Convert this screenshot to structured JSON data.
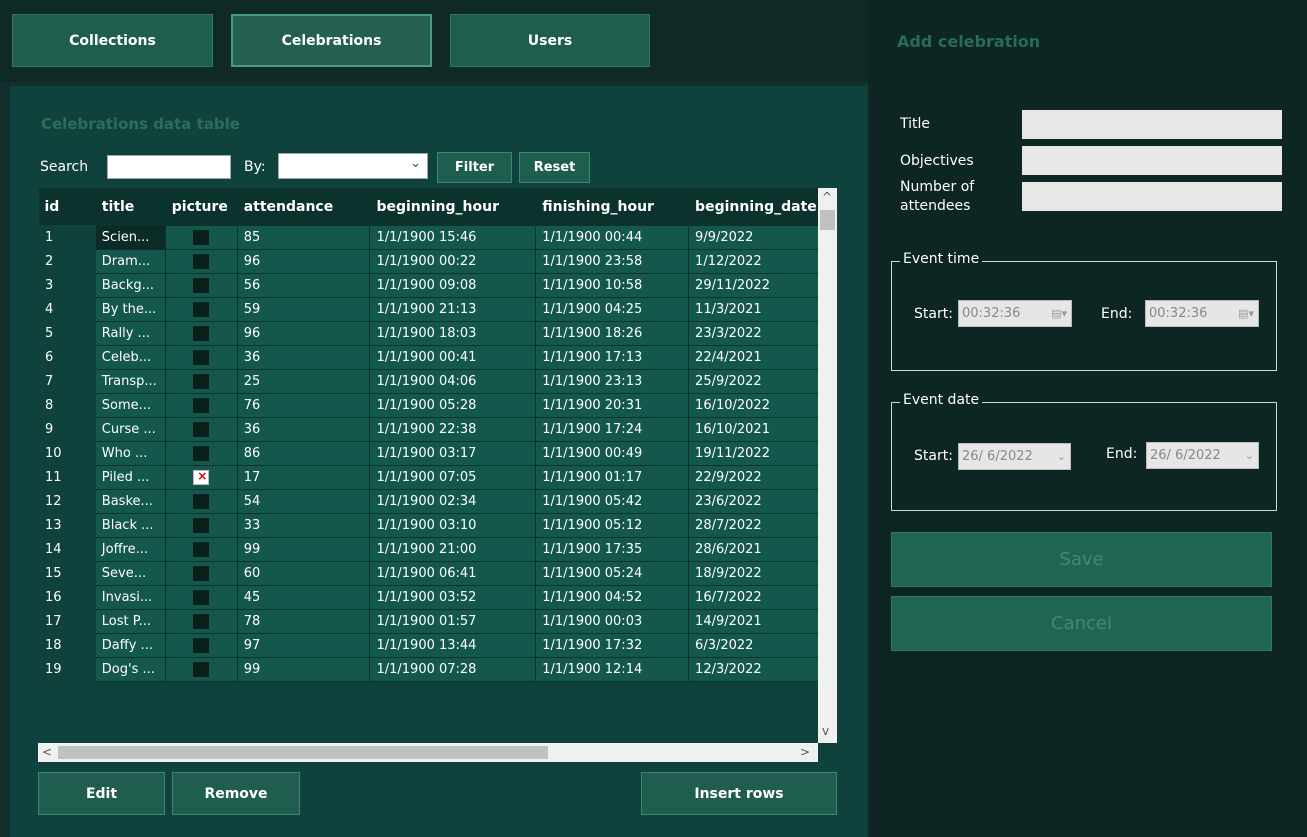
{
  "nav": {
    "collections": "Collections",
    "celebrations": "Celebrations",
    "users": "Users"
  },
  "app_title": "Add celebration",
  "table_title": "Celebrations data table",
  "search": {
    "label": "Search",
    "value": "",
    "by_label": "By:",
    "by_value": "",
    "filter": "Filter",
    "reset": "Reset"
  },
  "table": {
    "columns": [
      "id",
      "title",
      "picture",
      "attendance",
      "beginning_hour",
      "finishing_hour",
      "beginning_date"
    ],
    "rows": [
      [
        "1",
        "Scien...",
        "",
        "85",
        "1/1/1900 15:46",
        "1/1/1900 00:44",
        "9/9/2022"
      ],
      [
        "2",
        "Dram...",
        "",
        "96",
        "1/1/1900 00:22",
        "1/1/1900 23:58",
        "1/12/2022"
      ],
      [
        "3",
        "Backg...",
        "",
        "56",
        "1/1/1900 09:08",
        "1/1/1900 10:58",
        "29/11/2022"
      ],
      [
        "4",
        "By the...",
        "",
        "59",
        "1/1/1900 21:13",
        "1/1/1900 04:25",
        "11/3/2021"
      ],
      [
        "5",
        "Rally ...",
        "",
        "96",
        "1/1/1900 18:03",
        "1/1/1900 18:26",
        "23/3/2022"
      ],
      [
        "6",
        "Celeb...",
        "",
        "36",
        "1/1/1900 00:41",
        "1/1/1900 17:13",
        "22/4/2021"
      ],
      [
        "7",
        "Transp...",
        "",
        "25",
        "1/1/1900 04:06",
        "1/1/1900 23:13",
        "25/9/2022"
      ],
      [
        "8",
        "Some...",
        "",
        "76",
        "1/1/1900 05:28",
        "1/1/1900 20:31",
        "16/10/2022"
      ],
      [
        "9",
        "Curse ...",
        "",
        "36",
        "1/1/1900 22:38",
        "1/1/1900 17:24",
        "16/10/2021"
      ],
      [
        "10",
        "Who ...",
        "",
        "86",
        "1/1/1900 03:17",
        "1/1/1900 00:49",
        "19/11/2022"
      ],
      [
        "11",
        "Piled ...",
        "broken",
        "17",
        "1/1/1900 07:05",
        "1/1/1900 01:17",
        "22/9/2022"
      ],
      [
        "12",
        "Baske...",
        "",
        "54",
        "1/1/1900 02:34",
        "1/1/1900 05:42",
        "23/6/2022"
      ],
      [
        "13",
        "Black ...",
        "",
        "33",
        "1/1/1900 03:10",
        "1/1/1900 05:12",
        "28/7/2022"
      ],
      [
        "14",
        "Joffre...",
        "",
        "99",
        "1/1/1900 21:00",
        "1/1/1900 17:35",
        "28/6/2021"
      ],
      [
        "15",
        "Seve...",
        "",
        "60",
        "1/1/1900 06:41",
        "1/1/1900 05:24",
        "18/9/2022"
      ],
      [
        "16",
        "Invasi...",
        "",
        "45",
        "1/1/1900 03:52",
        "1/1/1900 04:52",
        "16/7/2022"
      ],
      [
        "17",
        "Lost P...",
        "",
        "78",
        "1/1/1900 01:57",
        "1/1/1900 00:03",
        "14/9/2021"
      ],
      [
        "18",
        "Daffy ...",
        "",
        "97",
        "1/1/1900 13:44",
        "1/1/1900 17:32",
        "6/3/2022"
      ],
      [
        "19",
        "Dog's ...",
        "",
        "99",
        "1/1/1900 07:28",
        "1/1/1900 12:14",
        "12/3/2022"
      ]
    ]
  },
  "actions": {
    "edit": "Edit",
    "remove": "Remove",
    "insert_rows": "Insert rows"
  },
  "form": {
    "title_label": "Title",
    "title_value": "",
    "objectives_label": "Objectives",
    "objectives_value": "",
    "attendees_label": "Number of attendees",
    "attendees_value": "",
    "event_time": {
      "group_label": "Event time",
      "start_label": "Start:",
      "start_value": "00:32:36",
      "end_label": "End:",
      "end_value": "00:32:36"
    },
    "event_date": {
      "group_label": "Event date",
      "start_label": "Start:",
      "start_value": "26/ 6/2022",
      "end_label": "End:",
      "end_value": "26/ 6/2022"
    },
    "save": "Save",
    "cancel": "Cancel"
  },
  "colors": {
    "background": "#11302c",
    "panel": "#0f423c",
    "button": "#1f5d4e",
    "title_accent": "#2a6b58"
  }
}
